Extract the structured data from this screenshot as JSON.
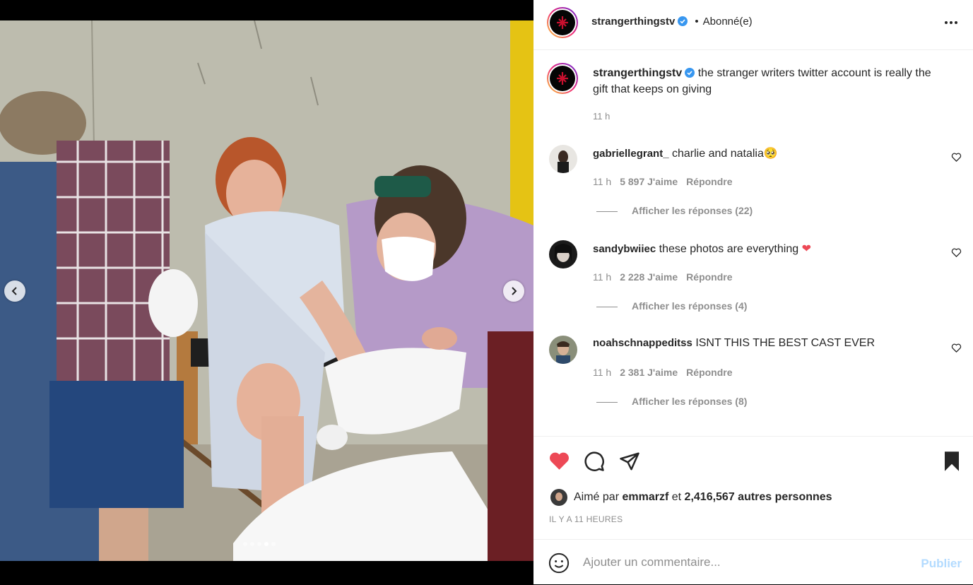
{
  "post": {
    "account": "stranger​thingstv",
    "follow_state": "Abonné(e)",
    "separator": "•"
  },
  "caption": {
    "username": "strangerthingstv",
    "text": "the stranger writers twitter account is really the gift that keeps on giving",
    "time": "11 h"
  },
  "comments": [
    {
      "username": "gabriellegrant_",
      "text": "charlie and natalia",
      "emoji": "🥺",
      "time": "11 h",
      "likes": "5 897 J'aime",
      "reply": "Répondre",
      "replies": "Afficher les réponses (22)"
    },
    {
      "username": "sandybwiiec",
      "text": "these photos are everything",
      "emoji": "❤",
      "time": "11 h",
      "likes": "2 228 J'aime",
      "reply": "Répondre",
      "replies": "Afficher les réponses (4)"
    },
    {
      "username": "noahschnappeditss",
      "text": "ISNT THIS THE BEST CAST EVER",
      "emoji": "",
      "time": "11 h",
      "likes": "2 381 J'aime",
      "reply": "Répondre",
      "replies": "Afficher les réponses (8)"
    }
  ],
  "likes": {
    "prefix": "Aimé par",
    "user": "emmarzf",
    "joiner": "et",
    "count": "2,416,567 autres personnes"
  },
  "timestamp": "IL Y A 11 HEURES",
  "comment_box": {
    "placeholder": "Ajouter un commentaire...",
    "post_label": "Publier"
  },
  "carousel": {
    "slide_count": 5,
    "active_index": 3
  },
  "colors": {
    "like_red": "#ed4956",
    "verified_blue": "#3897f0",
    "post_disabled": "#b3dbff"
  },
  "icons": [
    "chevron-left-icon",
    "chevron-right-icon",
    "heart-filled-icon",
    "comment-icon",
    "share-icon",
    "bookmark-icon",
    "emoji-icon",
    "verified-icon",
    "more-icon",
    "heart-outline-icon"
  ]
}
